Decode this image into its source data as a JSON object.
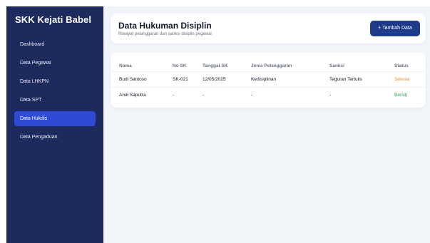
{
  "sidebar": {
    "brand": "SKK Kejati Babel",
    "items": [
      {
        "label": "Dashboard"
      },
      {
        "label": "Data Pegawai"
      },
      {
        "label": "Data LHKPN"
      },
      {
        "label": "Data SPT"
      },
      {
        "label": "Data Hukdis",
        "active": true
      },
      {
        "label": "Data Pengaduan"
      }
    ]
  },
  "header": {
    "title": "Data Hukuman Disiplin",
    "subtitle": "Riwayat pelanggaran dan sanksi disiplin pegawai",
    "add_button": "+ Tambah Data"
  },
  "table": {
    "columns": [
      "Nama",
      "No SK",
      "Tanggal SK",
      "Jenis Pelanggaran",
      "Sanksi",
      "Status"
    ],
    "rows": [
      [
        "Budi Santoso",
        "SK-021",
        "12/05/2025",
        "Kedisiplinan",
        "Teguran Tertulis",
        "Selesai"
      ],
      [
        "Andi Saputra",
        "-",
        "-",
        "-",
        "-",
        "Bersih"
      ]
    ]
  },
  "colors": {
    "sidebar_bg": "#1c2a5e",
    "active_item": "#2f4bd6",
    "primary_button": "#1e3a8a",
    "status_selesai": "#e88a2e",
    "status_bersih": "#22a55a"
  }
}
